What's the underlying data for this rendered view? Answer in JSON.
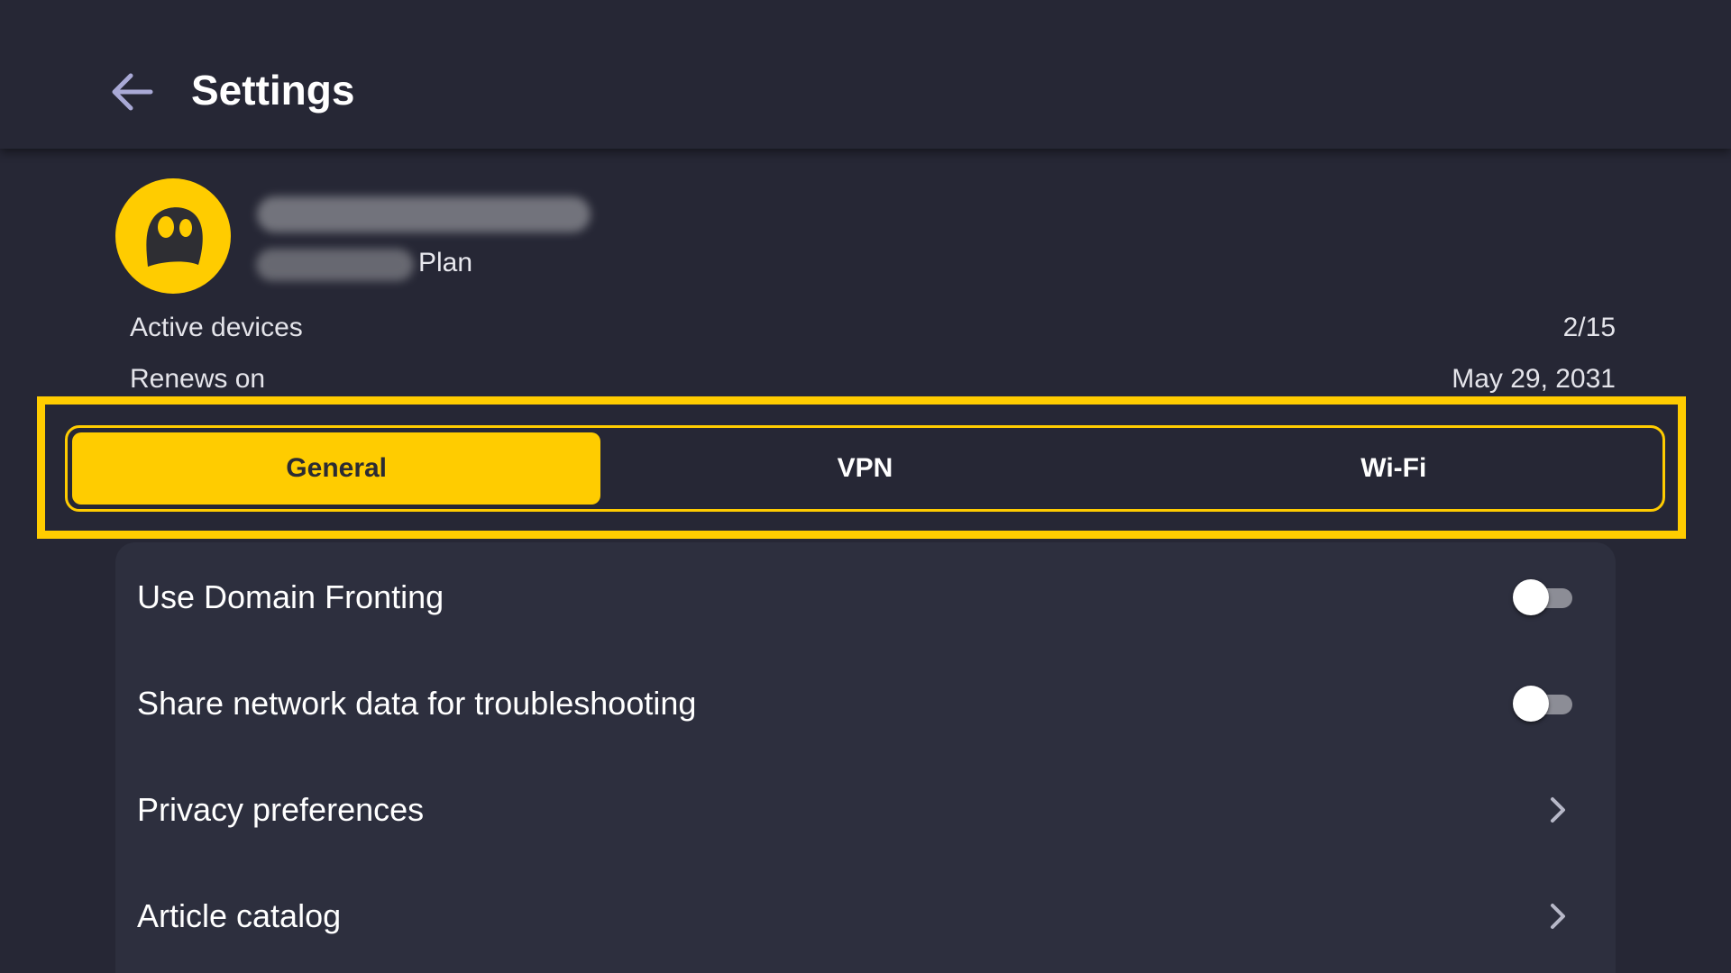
{
  "header": {
    "back_icon": "arrow-left-icon",
    "title": "Settings"
  },
  "profile": {
    "avatar_icon": "ghost-logo-icon",
    "plan_suffix": "Plan"
  },
  "account": {
    "active_devices_label": "Active devices",
    "active_devices_value": "2/15",
    "renews_label": "Renews on",
    "renews_value": "May 29, 2031"
  },
  "tabs": [
    {
      "label": "General",
      "active": true
    },
    {
      "label": "VPN",
      "active": false
    },
    {
      "label": "Wi-Fi",
      "active": false
    }
  ],
  "settings": [
    {
      "label": "Use Domain Fronting",
      "control": "toggle",
      "value": false
    },
    {
      "label": "Share network data for troubleshooting",
      "control": "toggle",
      "value": false
    },
    {
      "label": "Privacy preferences",
      "control": "chevron-right-icon"
    },
    {
      "label": "Article catalog",
      "control": "chevron-right-icon"
    }
  ],
  "colors": {
    "background": "#262735",
    "card": "#2d2f3e",
    "accent": "#ffcc00",
    "back_icon": "#a9a9d6"
  }
}
